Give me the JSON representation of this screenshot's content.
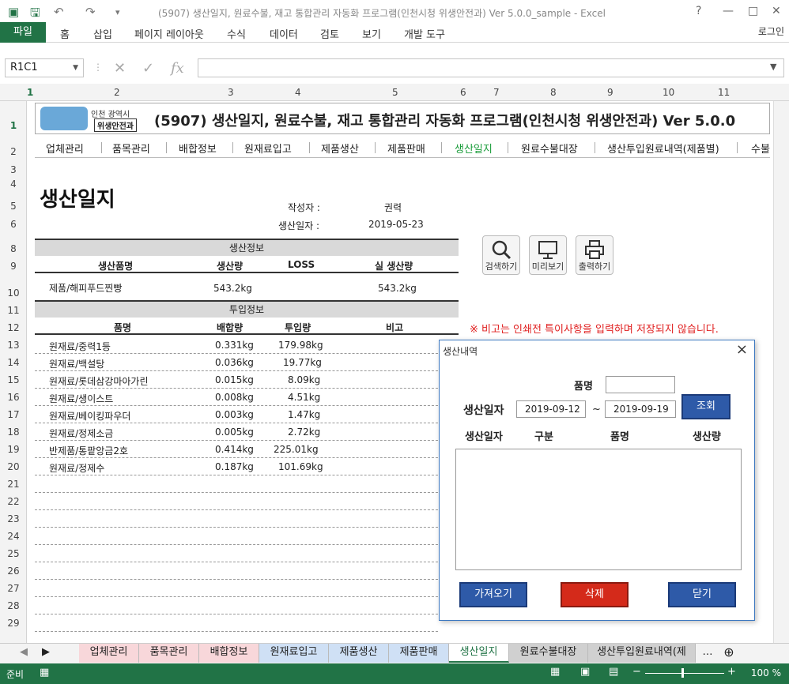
{
  "window": {
    "title": "(5907) 생산일지, 원료수불, 재고 통합관리 자동화 프로그램(인천시청 위생안전과) Ver 5.0.0_sample - Excel",
    "help": "?",
    "minimize": "—",
    "restore": "□",
    "close": "✕"
  },
  "ribbon": {
    "file": "파일",
    "tabs": [
      "홈",
      "삽입",
      "페이지 레이아웃",
      "수식",
      "데이터",
      "검토",
      "보기",
      "개발 도구"
    ],
    "login": "로그인"
  },
  "formula": {
    "namebox": "R1C1",
    "fx": "fx",
    "value": ""
  },
  "columns": [
    "1",
    "2",
    "3",
    "4",
    "5",
    "6",
    "7",
    "8",
    "9",
    "10",
    "11"
  ],
  "rows": [
    "1",
    "2",
    "3",
    "4",
    "5",
    "6",
    "8",
    "9",
    "10",
    "11",
    "12",
    "13",
    "14",
    "15",
    "16",
    "17",
    "18",
    "19",
    "20",
    "21",
    "22",
    "23",
    "24",
    "25",
    "26",
    "27",
    "28",
    "29"
  ],
  "banner": {
    "city": "인천 광역시",
    "dept": "위생안전과",
    "title": "(5907) 생산일지, 원료수불, 재고 통합관리 자동화 프로그램(인천시청 위생안전과) Ver 5.0.0"
  },
  "nav": [
    "업체관리",
    "품목관리",
    "배합정보",
    "원재료입고",
    "제품생산",
    "제품판매",
    "생산일지",
    "원료수불대장",
    "생산투입원료내역(제품별)",
    "수불"
  ],
  "doc": {
    "title": "생산일지",
    "author_label": "작성자 :",
    "author": "권력",
    "date_label": "생산일자 :",
    "date": "2019-05-23"
  },
  "production": {
    "section": "생산정보",
    "headers": [
      "생산품명",
      "생산량",
      "LOSS",
      "실 생산량"
    ],
    "row": {
      "name": "제품/해피푸드찐빵",
      "qty": "543.2kg",
      "loss": "",
      "real": "543.2kg"
    }
  },
  "input": {
    "section": "투입정보",
    "headers": [
      "품명",
      "배합량",
      "투입량",
      "비고"
    ],
    "rows": [
      {
        "name": "원재료/중력1등",
        "ratio": "0.331kg",
        "qty": "179.98kg"
      },
      {
        "name": "원재료/백설탕",
        "ratio": "0.036kg",
        "qty": "19.77kg"
      },
      {
        "name": "원재료/롯데삼강마아가린",
        "ratio": "0.015kg",
        "qty": "8.09kg"
      },
      {
        "name": "원재료/생이스트",
        "ratio": "0.008kg",
        "qty": "4.51kg"
      },
      {
        "name": "원재료/베이킹파우더",
        "ratio": "0.003kg",
        "qty": "1.47kg"
      },
      {
        "name": "원재료/정제소금",
        "ratio": "0.005kg",
        "qty": "2.72kg"
      },
      {
        "name": "반제품/통팥앙금2호",
        "ratio": "0.414kg",
        "qty": "225.01kg"
      },
      {
        "name": "원재료/정제수",
        "ratio": "0.187kg",
        "qty": "101.69kg"
      }
    ]
  },
  "tools": [
    "검색하기",
    "미리보기",
    "출력하기"
  ],
  "note": "※ 비고는 인쇄전 특이사항을 입력하며 저장되지 않습니다.",
  "dialog": {
    "title": "생산내역",
    "name_label": "품명",
    "name_value": "",
    "date_label": "생산일자",
    "date_from": "2019-09-12",
    "tilde": "~",
    "date_to": "2019-09-19",
    "query": "조회",
    "list_headers": [
      "생산일자",
      "구분",
      "품명",
      "생산량"
    ],
    "fetch": "가져오기",
    "delete": "삭제",
    "close": "닫기"
  },
  "sheet_tabs": [
    "업체관리",
    "품목관리",
    "배합정보",
    "원재료입고",
    "제품생산",
    "제품판매",
    "생산일지",
    "원료수불대장",
    "생산투입원료내역(제"
  ],
  "status": {
    "ready": "준비",
    "zoom": "100 %"
  },
  "colors": {
    "excel_green": "#217346",
    "active_nav": "#1a9c3a",
    "note_red": "#e02020",
    "dialog_blue": "#2e5aa8",
    "delete_red": "#d42a1a"
  }
}
